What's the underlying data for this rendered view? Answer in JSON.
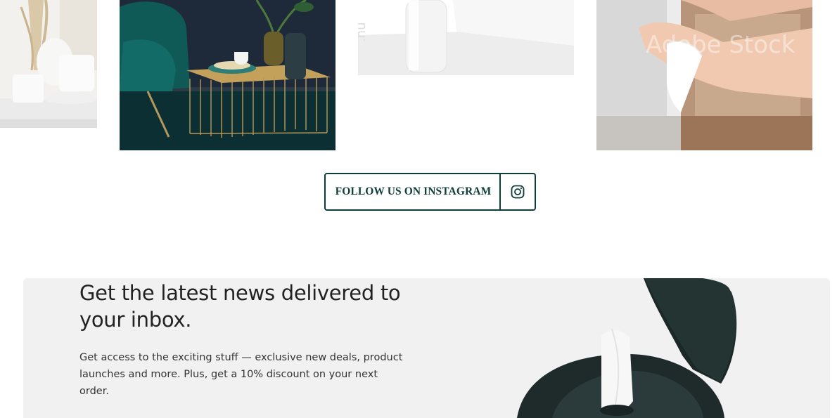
{
  "gallery": {
    "tiles": [
      {
        "name": "kitchenware-photo",
        "description_icon": "photo"
      },
      {
        "name": "teal-armchair-photo",
        "description_icon": "photo"
      },
      {
        "name": "white-bottle-photo",
        "description_icon": "photo"
      },
      {
        "name": "hands-wipe-photo",
        "description_icon": "photo",
        "watermark": "Adobe Stock"
      }
    ]
  },
  "instagram": {
    "label": "FOLLOW US ON INSTAGRAM",
    "icon": "instagram-icon"
  },
  "newsletter": {
    "title": "Get the latest news delivered to your inbox.",
    "body": "Get access to the exciting stuff — exclusive new deals, product launches and more. Plus, get a 10% discount on your next order."
  },
  "colors": {
    "brand_dark_green": "#0f3d3a",
    "newsletter_bg": "#f1f1f1",
    "text_dark": "#222222"
  }
}
